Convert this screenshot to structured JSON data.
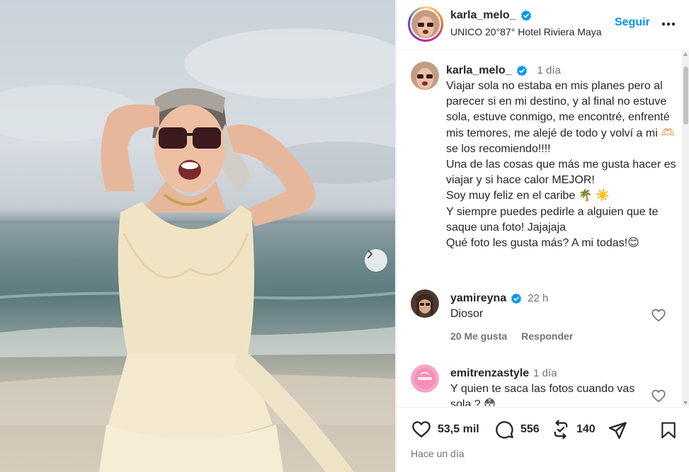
{
  "post": {
    "username": "karla_melo_",
    "location": "UNICO 20°87° Hotel Riviera Maya",
    "follow_label": "Seguir",
    "more_icon": "more-horizontal-icon",
    "verified_color": "#0095f6"
  },
  "caption": {
    "username": "karla_melo_",
    "time": "1 día",
    "text": "Viajar sola no estaba en mis planes pero al parecer si en mi destino, y al final no estuve sola, estuve conmigo, me encontré, enfrenté mis temores, me alejé de todo y volví a mi 🫶🏻 se los recomiendo!!!!\nUna de las cosas que más me gusta hacer es viajar y si hace calor MEJOR!\nSoy muy feliz en el caribe 🌴 ☀️\nY siempre puedes pedirle a alguien que te saque una foto! Jajajaja\nQué foto les gusta más? A mi todas!😊"
  },
  "comments": [
    {
      "username": "yamireyna",
      "verified": true,
      "time": "22 h",
      "text": "Diosor",
      "likes": "20 Me gusta",
      "reply": "Responder"
    },
    {
      "username": "emitrenzastyle",
      "verified": false,
      "time": "1 día",
      "text": "Y quien te saca las fotos cuando vas sola ? 😳"
    }
  ],
  "actions": {
    "likes": "53,5 mil",
    "comments": "556",
    "reposts": "140",
    "posted": "Hace un día"
  },
  "colors": {
    "accent": "#0095f6",
    "text": "#262626",
    "muted": "#737373"
  }
}
